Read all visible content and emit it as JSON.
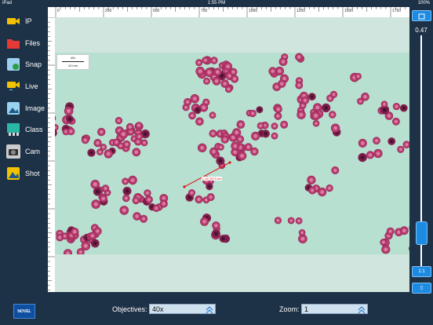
{
  "status": {
    "device": "iPad",
    "time": "1:55 PM",
    "battery": "100%"
  },
  "sidebar": {
    "items": [
      {
        "label": "IP",
        "icon": "camera-ip-icon",
        "color": "#f2c200"
      },
      {
        "label": "Files",
        "icon": "folder-icon",
        "color": "#e53935"
      },
      {
        "label": "Snap",
        "icon": "snapshot-icon",
        "color": "#9ad1f0"
      },
      {
        "label": "Live",
        "icon": "live-video-icon",
        "color": "#f2c200"
      },
      {
        "label": "Image",
        "icon": "image-icon",
        "color": "#9ad1f0"
      },
      {
        "label": "Class",
        "icon": "classroom-icon",
        "color": "#2bb7a6"
      },
      {
        "label": "Cam",
        "icon": "camera-icon",
        "color": "#cccccc"
      },
      {
        "label": "Shot",
        "icon": "screenshot-icon",
        "color": "#f2c200"
      }
    ]
  },
  "ruler": {
    "top_ticks": [
      "0",
      "250",
      "500",
      "750",
      "1000",
      "1250",
      "1500",
      "1750"
    ]
  },
  "scalebar": {
    "top_label": "40x",
    "bottom_label": "10 mm"
  },
  "measurement": {
    "label": "L:16.7673 um"
  },
  "zoom_panel": {
    "value": "0.47",
    "level": 0.47,
    "btn_1to1": "1:1",
    "btn_fit": "▯"
  },
  "bottom": {
    "logo": "NOVEL",
    "objectives_label": "Objectives:",
    "objectives_value": "40x",
    "zoom_label": "Zoom:",
    "zoom_value": "1"
  }
}
